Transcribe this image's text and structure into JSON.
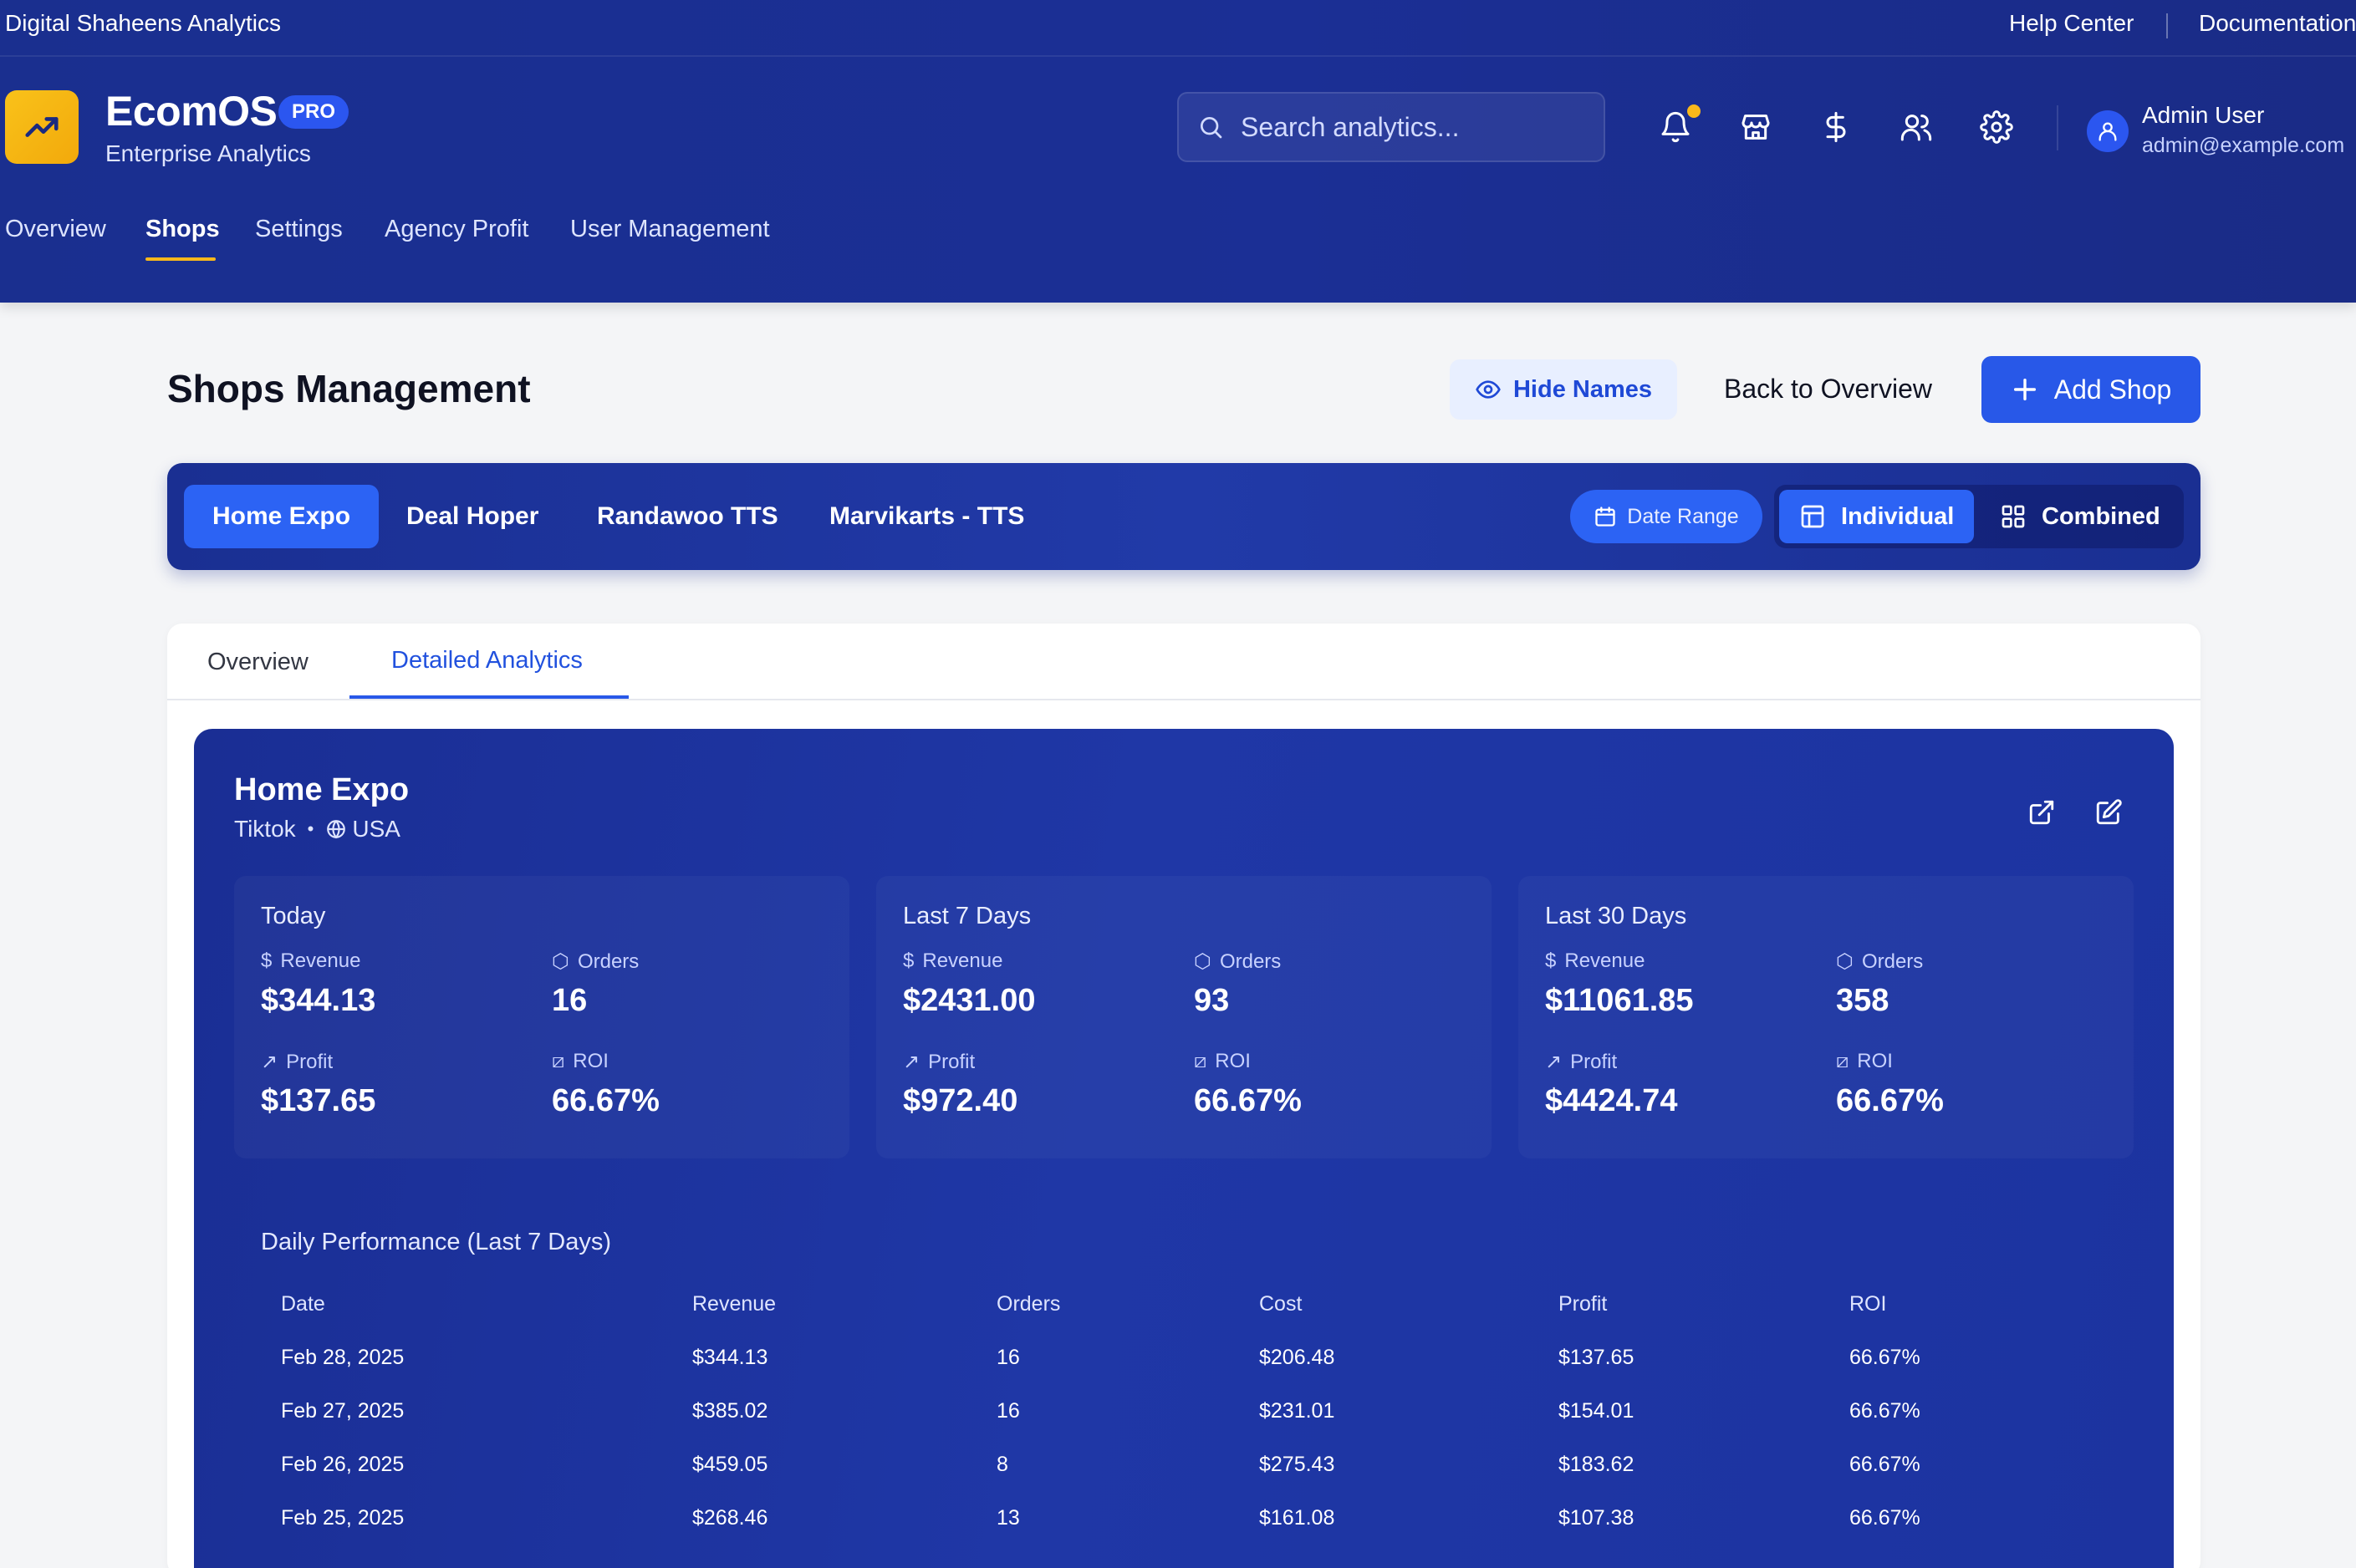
{
  "topbar": {
    "company": "Digital Shaheens Analytics",
    "help": "Help Center",
    "docs": "Documentation"
  },
  "brand": {
    "name": "EcomOS",
    "badge": "PRO",
    "subtitle": "Enterprise Analytics"
  },
  "search": {
    "placeholder": "Search analytics..."
  },
  "user": {
    "name": "Admin User",
    "email": "admin@example.com"
  },
  "nav": {
    "tabs": [
      "Overview",
      "Shops",
      "Settings",
      "Agency Profit",
      "User Management"
    ],
    "active": "Shops"
  },
  "page": {
    "title": "Shops Management",
    "hide_names": "Hide Names",
    "back": "Back to Overview",
    "add_shop": "Add Shop"
  },
  "shopbar": {
    "shops": [
      "Home Expo",
      "Deal Hoper",
      "Randawoo TTS",
      "Marvikarts - TTS"
    ],
    "active_shop": "Home Expo",
    "date_range": "Date Range",
    "view_individual": "Individual",
    "view_combined": "Combined",
    "active_view": "Individual"
  },
  "subtabs": {
    "overview": "Overview",
    "detailed": "Detailed Analytics",
    "active": "Detailed Analytics"
  },
  "shop": {
    "name": "Home Expo",
    "platform": "Tiktok",
    "region": "USA"
  },
  "labels": {
    "revenue": "Revenue",
    "orders": "Orders",
    "profit": "Profit",
    "roi": "ROI"
  },
  "periods": [
    {
      "title": "Today",
      "revenue": "$344.13",
      "orders": "16",
      "profit": "$137.65",
      "roi": "66.67%"
    },
    {
      "title": "Last 7 Days",
      "revenue": "$2431.00",
      "orders": "93",
      "profit": "$972.40",
      "roi": "66.67%"
    },
    {
      "title": "Last 30 Days",
      "revenue": "$11061.85",
      "orders": "358",
      "profit": "$4424.74",
      "roi": "66.67%"
    }
  ],
  "daily": {
    "title": "Daily Performance (Last 7 Days)",
    "headers": [
      "Date",
      "Revenue",
      "Orders",
      "Cost",
      "Profit",
      "ROI"
    ],
    "rows": [
      [
        "Feb 28, 2025",
        "$344.13",
        "16",
        "$206.48",
        "$137.65",
        "66.67%"
      ],
      [
        "Feb 27, 2025",
        "$385.02",
        "16",
        "$231.01",
        "$154.01",
        "66.67%"
      ],
      [
        "Feb 26, 2025",
        "$459.05",
        "8",
        "$275.43",
        "$183.62",
        "66.67%"
      ],
      [
        "Feb 25, 2025",
        "$268.46",
        "13",
        "$161.08",
        "$107.38",
        "66.67%"
      ]
    ]
  },
  "colors": {
    "header_bg": "#1b2f95",
    "accent": "#2858e8",
    "logo": "#f9c21a",
    "notification_dot": "#f9b81b",
    "page_bg": "#f4f5f7"
  }
}
